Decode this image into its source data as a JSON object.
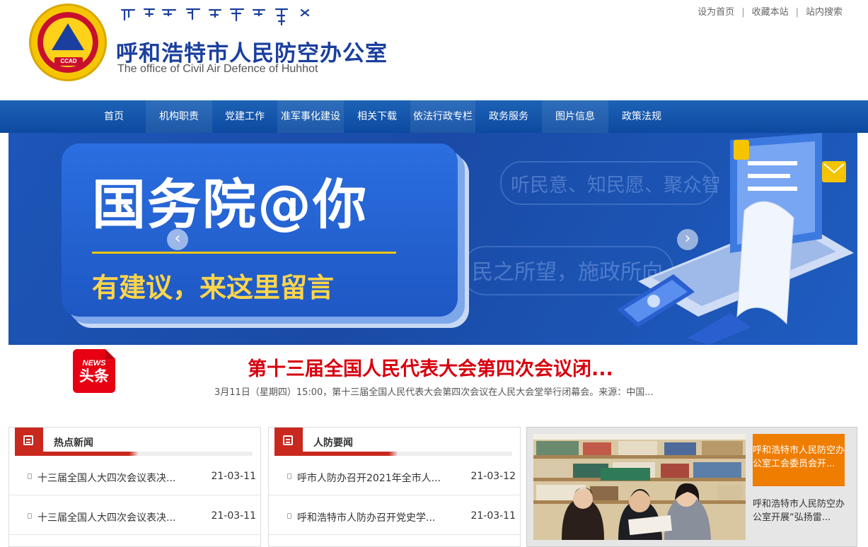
{
  "header": {
    "org_name_cn": "呼和浩特市人民防空办公室",
    "org_name_en": "The office of Civil Air Defence  of Huhhot",
    "logo_text": "CCAD",
    "links": [
      "设为首页",
      "收藏本站",
      "站内搜索"
    ]
  },
  "nav": {
    "items": [
      "首页",
      "机构职责",
      "党建工作",
      "准军事化建设",
      "相关下载",
      "依法行政专栏",
      "政务服务",
      "图片信息",
      "政策法规"
    ]
  },
  "banner": {
    "headline": "国务院@你",
    "subline": "有建议，来这里留言",
    "bg_text_1": "听民意、知民愿、聚众智",
    "bg_text_2": "民之所望，施政所向",
    "prev_icon": "‹",
    "next_icon": "›"
  },
  "lead_news": {
    "badge_en": "NEWS",
    "badge_cn": "头条",
    "title": "第十三届全国人民代表大会第四次会议闭...",
    "summary": "3月11日（星期四）15:00，第十三届全国人民代表大会第四次会议在人民大会堂举行闭幕会。来源：中国..."
  },
  "panels": {
    "hot": {
      "label": "热点新闻",
      "items": [
        {
          "title": "十三届全国人大四次会议表决...",
          "date": "21-03-11"
        },
        {
          "title": "十三届全国人大四次会议表决...",
          "date": "21-03-11"
        }
      ]
    },
    "civil": {
      "label": "人防要闻",
      "items": [
        {
          "title": "呼市人防办召开2021年全市人...",
          "date": "21-03-12"
        },
        {
          "title": "呼和浩特市人防办召开党史学...",
          "date": "21-03-11"
        }
      ]
    }
  },
  "photo_news": {
    "captions": [
      "呼和浩特市人民防空办公室工会委员会开...",
      "呼和浩特市人民防空办公室开展“弘扬雷..."
    ]
  },
  "colors": {
    "nav_blue": "#0c4aa0",
    "brand_blue": "#1a3f9e",
    "news_red": "#d7000f",
    "accent_orange": "#ef7d00"
  }
}
